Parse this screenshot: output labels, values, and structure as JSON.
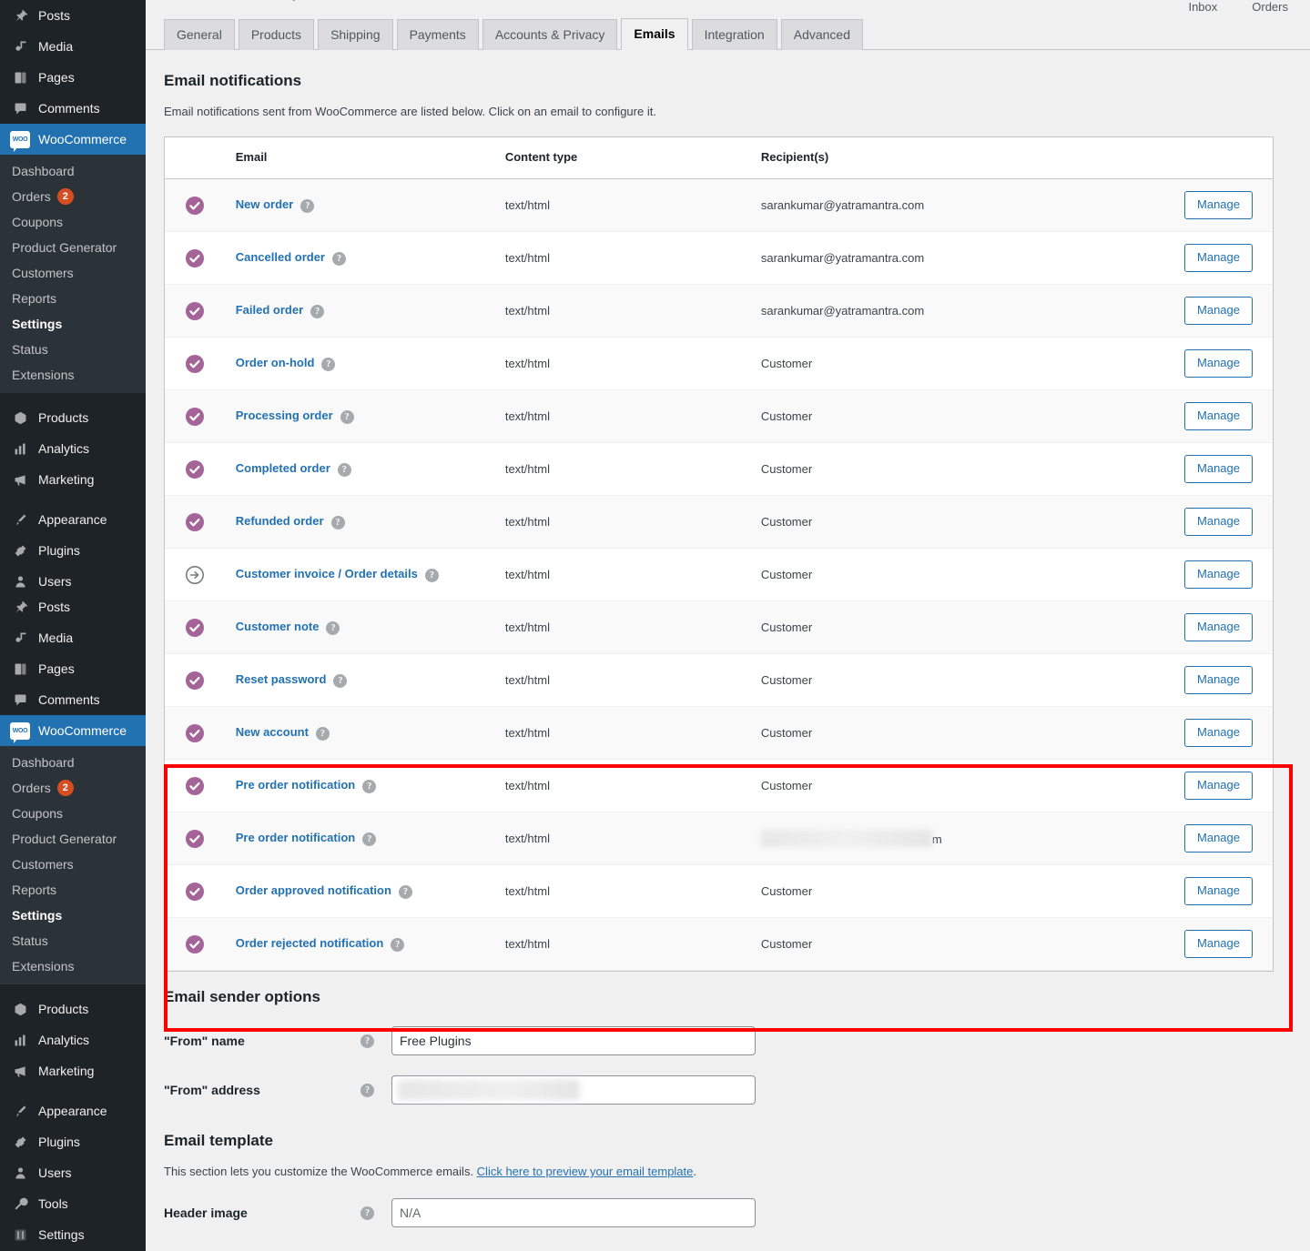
{
  "sidebar": {
    "top_items": [
      {
        "label": "Posts",
        "icon": "pin-icon"
      },
      {
        "label": "Media",
        "icon": "media-icon"
      },
      {
        "label": "Pages",
        "icon": "pages-icon"
      },
      {
        "label": "Comments",
        "icon": "comments-icon"
      }
    ],
    "woocommerce_label": "WooCommerce",
    "woo_logo_text": "WOO",
    "woo_submenu": [
      {
        "label": "Dashboard",
        "active": false
      },
      {
        "label": "Orders",
        "active": false,
        "badge": "2"
      },
      {
        "label": "Coupons",
        "active": false
      },
      {
        "label": "Product Generator",
        "active": false
      },
      {
        "label": "Customers",
        "active": false
      },
      {
        "label": "Reports",
        "active": false
      },
      {
        "label": "Settings",
        "active": true
      },
      {
        "label": "Status",
        "active": false
      },
      {
        "label": "Extensions",
        "active": false
      }
    ],
    "mid_items": [
      {
        "label": "Products",
        "icon": "products-icon"
      },
      {
        "label": "Analytics",
        "icon": "analytics-icon"
      },
      {
        "label": "Marketing",
        "icon": "marketing-icon"
      }
    ],
    "bottom_items": [
      {
        "label": "Appearance",
        "icon": "appearance-icon"
      },
      {
        "label": "Plugins",
        "icon": "plugins-icon"
      },
      {
        "label": "Users",
        "icon": "users-icon"
      }
    ],
    "repeat_items": [
      {
        "label": "Posts",
        "icon": "pin-icon"
      },
      {
        "label": "Media",
        "icon": "media-icon"
      },
      {
        "label": "Pages",
        "icon": "pages-icon"
      },
      {
        "label": "Comments",
        "icon": "comments-icon"
      }
    ],
    "final_items": [
      {
        "label": "Products",
        "icon": "products-icon"
      },
      {
        "label": "Analytics",
        "icon": "analytics-icon"
      },
      {
        "label": "Marketing",
        "icon": "marketing-icon"
      }
    ],
    "last_items": [
      {
        "label": "Appearance",
        "icon": "appearance-icon"
      },
      {
        "label": "Plugins",
        "icon": "plugins-icon"
      },
      {
        "label": "Users",
        "icon": "users-icon"
      },
      {
        "label": "Tools",
        "icon": "tools-icon"
      },
      {
        "label": "Settings",
        "icon": "settings-icon"
      }
    ]
  },
  "topbar": {
    "inbox_label": "Inbox",
    "orders_label": "Orders"
  },
  "tabs": [
    {
      "label": "General",
      "active": false
    },
    {
      "label": "Products",
      "active": false
    },
    {
      "label": "Shipping",
      "active": false
    },
    {
      "label": "Payments",
      "active": false
    },
    {
      "label": "Accounts & Privacy",
      "active": false
    },
    {
      "label": "Emails",
      "active": true
    },
    {
      "label": "Integration",
      "active": false
    },
    {
      "label": "Advanced",
      "active": false
    }
  ],
  "page": {
    "notifications_heading": "Email notifications",
    "notifications_desc": "Email notifications sent from WooCommerce are listed below. Click on an email to configure it.",
    "sender_heading": "Email sender options",
    "template_heading": "Email template",
    "template_desc_before": "This section lets you customize the WooCommerce emails. ",
    "template_link": "Click here to preview your email template",
    "template_desc_after": "."
  },
  "table": {
    "columns": [
      "",
      "Email",
      "Content type",
      "Recipient(s)",
      ""
    ],
    "manage_label": "Manage",
    "help_glyph": "?",
    "rows": [
      {
        "status": "enabled",
        "email": "New order",
        "content_type": "text/html",
        "recipient": "sarankumar@yatramantra.com",
        "action": "Manage"
      },
      {
        "status": "enabled",
        "email": "Cancelled order",
        "content_type": "text/html",
        "recipient": "sarankumar@yatramantra.com",
        "action": "Manage"
      },
      {
        "status": "enabled",
        "email": "Failed order",
        "content_type": "text/html",
        "recipient": "sarankumar@yatramantra.com",
        "action": "Manage"
      },
      {
        "status": "enabled",
        "email": "Order on-hold",
        "content_type": "text/html",
        "recipient": "Customer",
        "action": "Manage"
      },
      {
        "status": "enabled",
        "email": "Processing order",
        "content_type": "text/html",
        "recipient": "Customer",
        "action": "Manage"
      },
      {
        "status": "enabled",
        "email": "Completed order",
        "content_type": "text/html",
        "recipient": "Customer",
        "action": "Manage"
      },
      {
        "status": "enabled",
        "email": "Refunded order",
        "content_type": "text/html",
        "recipient": "Customer",
        "action": "Manage"
      },
      {
        "status": "manual",
        "email": "Customer invoice / Order details",
        "content_type": "text/html",
        "recipient": "Customer",
        "action": "Manage"
      },
      {
        "status": "enabled",
        "email": "Customer note",
        "content_type": "text/html",
        "recipient": "Customer",
        "action": "Manage"
      },
      {
        "status": "enabled",
        "email": "Reset password",
        "content_type": "text/html",
        "recipient": "Customer",
        "action": "Manage"
      },
      {
        "status": "enabled",
        "email": "New account",
        "content_type": "text/html",
        "recipient": "Customer",
        "action": "Manage"
      },
      {
        "status": "enabled",
        "email": "Pre order notification",
        "content_type": "text/html",
        "recipient": "Customer",
        "action": "Manage",
        "highlighted": true
      },
      {
        "status": "enabled",
        "email": "Pre order notification",
        "content_type": "text/html",
        "recipient": "",
        "recipient_redacted": true,
        "recipient_suffix": "m",
        "action": "Manage",
        "highlighted": true
      },
      {
        "status": "enabled",
        "email": "Order approved notification",
        "content_type": "text/html",
        "recipient": "Customer",
        "action": "Manage",
        "highlighted": true
      },
      {
        "status": "enabled",
        "email": "Order rejected notification",
        "content_type": "text/html",
        "recipient": "Customer",
        "action": "Manage",
        "highlighted": true
      }
    ]
  },
  "form": {
    "from_name_label": "\"From\" name",
    "from_name_value": "Free Plugins",
    "from_address_label": "\"From\" address",
    "from_address_value": "",
    "header_image_label": "Header image",
    "header_image_placeholder": "N/A"
  },
  "colors": {
    "accent_blue": "#2271b1",
    "status_purple": "#a46497",
    "highlight_red": "#ff0000",
    "sidebar_bg": "#1d2327",
    "submenu_bg": "#2c3338",
    "badge_orange": "#d54e21"
  }
}
